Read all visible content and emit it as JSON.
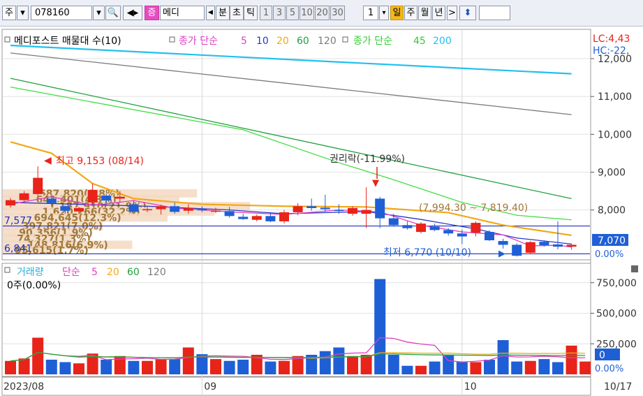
{
  "toolbar": {
    "market": "주",
    "code": "078160",
    "name_short": "메디",
    "jeung": "증",
    "chart_type": "분",
    "cho": "초",
    "tick": "틱",
    "periods": [
      "1",
      "3",
      "5",
      "10",
      "20",
      "30"
    ],
    "interval": "1",
    "day": "일",
    "week": "주",
    "month": "월",
    "year": "년"
  },
  "colors": {
    "up": "#e8231a",
    "down": "#1f5fd6",
    "ma5": "#e040c0",
    "ma10": "#2a36c8",
    "ma20": "#f0a818",
    "ma60": "#22a040",
    "ma120": "#7a7a7a",
    "ma45": "#44dd44",
    "ma200": "#22c0ee",
    "gold_text": "#a07838"
  },
  "chart_data": {
    "type": "candlestick",
    "price_legend": {
      "title": "메디포스트 매물대 수(10)",
      "ma_group1": "종가 단순",
      "ma_group1_periods": [
        "5",
        "10",
        "20",
        "60",
        "120"
      ],
      "ma_group2": "종가 단순",
      "ma_group2_periods": [
        "45",
        "200"
      ]
    },
    "corner_labels": {
      "lc": "LC:4,43",
      "hc": "HC:-22,"
    },
    "price_axis": {
      "ticks": [
        12000,
        11000,
        10000,
        9000,
        8000
      ],
      "tick_labels": [
        "12,000",
        "11,000",
        "10,000",
        "9,000",
        "8,000"
      ],
      "ylim": [
        6720,
        12350
      ]
    },
    "current_price_label": "7,070",
    "current_pct_label": "0.00%",
    "candles": [
      {
        "o": 8120,
        "h": 8320,
        "l": 8060,
        "c": 8260
      },
      {
        "o": 8260,
        "h": 8500,
        "l": 8220,
        "c": 8440
      },
      {
        "o": 8420,
        "h": 9153,
        "l": 8350,
        "c": 8850
      },
      {
        "o": 8300,
        "h": 8350,
        "l": 8100,
        "c": 8180
      },
      {
        "o": 8100,
        "h": 8120,
        "l": 7900,
        "c": 7980
      },
      {
        "o": 7960,
        "h": 8080,
        "l": 7900,
        "c": 8050
      },
      {
        "o": 8200,
        "h": 8700,
        "l": 8150,
        "c": 8530
      },
      {
        "o": 8380,
        "h": 8430,
        "l": 8200,
        "c": 8250
      },
      {
        "o": 8300,
        "h": 8500,
        "l": 8200,
        "c": 8350
      },
      {
        "o": 8150,
        "h": 8250,
        "l": 7900,
        "c": 7950
      },
      {
        "o": 8000,
        "h": 8090,
        "l": 7940,
        "c": 8020
      },
      {
        "o": 8020,
        "h": 8140,
        "l": 7880,
        "c": 8100
      },
      {
        "o": 8100,
        "h": 8200,
        "l": 7900,
        "c": 7950
      },
      {
        "o": 7980,
        "h": 8150,
        "l": 7900,
        "c": 8050
      },
      {
        "o": 8020,
        "h": 8100,
        "l": 7940,
        "c": 7990
      },
      {
        "o": 7960,
        "h": 8060,
        "l": 7920,
        "c": 7980
      },
      {
        "o": 7970,
        "h": 8080,
        "l": 7800,
        "c": 7840
      },
      {
        "o": 7820,
        "h": 7900,
        "l": 7740,
        "c": 7760
      },
      {
        "o": 7740,
        "h": 7880,
        "l": 7700,
        "c": 7840
      },
      {
        "o": 7840,
        "h": 7920,
        "l": 7680,
        "c": 7700
      },
      {
        "o": 7700,
        "h": 8000,
        "l": 7640,
        "c": 7940
      },
      {
        "o": 7940,
        "h": 8180,
        "l": 7860,
        "c": 8100
      },
      {
        "o": 8100,
        "h": 8300,
        "l": 7980,
        "c": 8050
      },
      {
        "o": 8060,
        "h": 8400,
        "l": 7950,
        "c": 8020
      },
      {
        "o": 8000,
        "h": 8150,
        "l": 7900,
        "c": 7980
      },
      {
        "o": 7900,
        "h": 8100,
        "l": 7850,
        "c": 8050
      },
      {
        "o": 7900,
        "h": 8600,
        "l": 7520,
        "c": 8000
      },
      {
        "o": 8300,
        "h": 8350,
        "l": 7520,
        "c": 7780
      },
      {
        "o": 7780,
        "h": 7900,
        "l": 7560,
        "c": 7600
      },
      {
        "o": 7600,
        "h": 7700,
        "l": 7480,
        "c": 7520
      },
      {
        "o": 7420,
        "h": 7680,
        "l": 7380,
        "c": 7640
      },
      {
        "o": 7560,
        "h": 7640,
        "l": 7440,
        "c": 7470
      },
      {
        "o": 7470,
        "h": 7520,
        "l": 7320,
        "c": 7380
      },
      {
        "o": 7380,
        "h": 7480,
        "l": 7100,
        "c": 7300
      },
      {
        "o": 7400,
        "h": 7700,
        "l": 7300,
        "c": 7660
      },
      {
        "o": 7420,
        "h": 7460,
        "l": 7180,
        "c": 7200
      },
      {
        "o": 7180,
        "h": 7240,
        "l": 6980,
        "c": 7080
      },
      {
        "o": 7080,
        "h": 7120,
        "l": 6770,
        "c": 6790
      },
      {
        "o": 6870,
        "h": 7180,
        "l": 6840,
        "c": 7150
      },
      {
        "o": 7160,
        "h": 7200,
        "l": 7030,
        "c": 7070
      },
      {
        "o": 7090,
        "h": 7700,
        "l": 6960,
        "c": 7030
      },
      {
        "o": 7030,
        "h": 7100,
        "l": 6950,
        "c": 7080
      }
    ],
    "ma_lines": [
      {
        "period": "200",
        "color": "#22c0ee",
        "points": [
          [
            0,
            12350
          ],
          [
            41,
            11600
          ]
        ]
      },
      {
        "period": "120",
        "color": "#7a7a7a",
        "points": [
          [
            0,
            12150
          ],
          [
            41,
            10520
          ]
        ]
      },
      {
        "period": "60",
        "color": "#22a040",
        "points": [
          [
            0,
            11480
          ],
          [
            41,
            8300
          ]
        ]
      },
      {
        "period": "45",
        "color": "#44dd44",
        "points": [
          [
            0,
            11250
          ],
          [
            17,
            10120
          ],
          [
            24,
            9250
          ],
          [
            28,
            8800
          ],
          [
            33,
            8200
          ],
          [
            37,
            7860
          ],
          [
            41,
            7740
          ]
        ]
      },
      {
        "period": "20",
        "color": "#f0a818",
        "points": [
          [
            0,
            9800
          ],
          [
            3,
            9500
          ],
          [
            6,
            8700
          ],
          [
            9,
            8300
          ],
          [
            14,
            8150
          ],
          [
            20,
            8100
          ],
          [
            26,
            8080
          ],
          [
            32,
            7930
          ],
          [
            36,
            7600
          ],
          [
            41,
            7330
          ]
        ]
      },
      {
        "period": "10",
        "color": "#2a36c8",
        "points": [
          [
            0,
            8200
          ],
          [
            5,
            8150
          ],
          [
            10,
            8100
          ],
          [
            16,
            8000
          ],
          [
            20,
            7900
          ],
          [
            26,
            7960
          ],
          [
            30,
            7750
          ],
          [
            34,
            7500
          ],
          [
            37,
            7260
          ],
          [
            41,
            7100
          ]
        ]
      },
      {
        "period": "5",
        "color": "#e040c0",
        "points": [
          [
            0,
            8150
          ],
          [
            3,
            8350
          ],
          [
            6,
            8120
          ],
          [
            9,
            8250
          ],
          [
            12,
            8050
          ],
          [
            16,
            7950
          ],
          [
            20,
            7880
          ],
          [
            24,
            8000
          ],
          [
            27,
            7950
          ],
          [
            30,
            7600
          ],
          [
            33,
            7420
          ],
          [
            36,
            7340
          ],
          [
            38,
            7050
          ],
          [
            40,
            7070
          ],
          [
            41,
            7020
          ]
        ]
      }
    ],
    "horizontal_lines": [
      {
        "price": 7577,
        "color": "#2030c0",
        "label": "7,577"
      },
      {
        "price": 6841,
        "color": "#2030c0",
        "label": "6,841"
      }
    ],
    "volume_profile": [
      {
        "price": 8440,
        "width": 0.33,
        "label": "587,820(9.8%)"
      },
      {
        "price": 8280,
        "width": 0.3,
        "label": "641,401(4.3%)"
      },
      {
        "price": 8100,
        "width": 0.42,
        "label": "1,187,910(21.9%)"
      },
      {
        "price": 7960,
        "width": 0.36,
        "label": "1,620,266(32.2%)"
      },
      {
        "price": 7800,
        "width": 0.28,
        "label": "694,645(12.3%)"
      },
      {
        "price": 7580,
        "width": 0.17,
        "label": "397,821(7.0%)"
      },
      {
        "price": 7400,
        "width": 0.14,
        "label": "90,356(1.9%)"
      },
      {
        "price": 7250,
        "width": 0.12,
        "label": "74,327(1.3%)"
      },
      {
        "price": 7080,
        "width": 0.22,
        "label": "148,816(6.9%)"
      },
      {
        "price": 6940,
        "width": 0.1,
        "label": "95,615(1.7%)"
      }
    ],
    "annotations": {
      "high": "최고 9,153 (08/14)",
      "low": "최저 6,770 (10/10)",
      "ex_rights": "권리락(-11.99%)",
      "range": "(7,994.30 ~ 7,819.40)"
    },
    "volume_panel": {
      "legend_title": "거래량",
      "ma_label": "단순",
      "ma_periods": [
        "5",
        "20",
        "60",
        "120"
      ],
      "info": "0주(0.00%)",
      "axis_ticks": [
        750000,
        500000,
        250000
      ],
      "tick_labels": [
        "750,000",
        "500,000",
        "250,000"
      ],
      "current_label": "0",
      "current_pct_label": "0.00%",
      "ylim": [
        0,
        800000
      ],
      "values": [
        110000,
        130000,
        300000,
        120000,
        100000,
        90000,
        170000,
        120000,
        150000,
        110000,
        110000,
        125000,
        125000,
        220000,
        165000,
        125000,
        110000,
        120000,
        160000,
        105000,
        110000,
        150000,
        160000,
        190000,
        220000,
        150000,
        160000,
        780000,
        160000,
        70000,
        70000,
        105000,
        155000,
        105000,
        100000,
        120000,
        280000,
        105000,
        110000,
        125000,
        100000,
        235000,
        105000
      ]
    },
    "x_axis": [
      {
        "index": 0,
        "label": "2023/08"
      },
      {
        "index": 14,
        "label": "09"
      },
      {
        "index": 33,
        "label": "10"
      },
      {
        "index": 41,
        "label": "10/17"
      }
    ]
  }
}
